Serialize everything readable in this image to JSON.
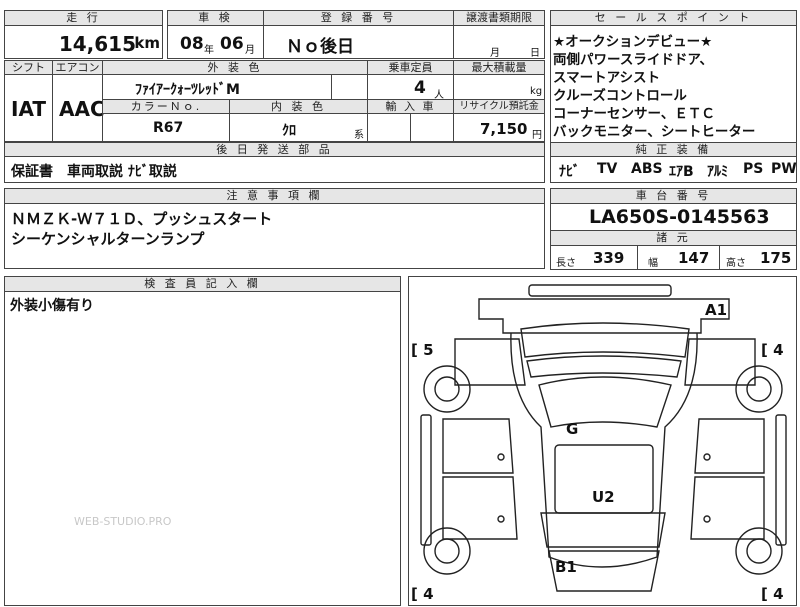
{
  "top": {
    "mileage_label": "走 行",
    "mileage_value": "14,615",
    "mileage_unit": "km",
    "inspection_label": "車 検",
    "inspection_year": "08",
    "inspection_year_unit": "年",
    "inspection_month": "06",
    "inspection_month_unit": "月",
    "registration_label": "登 録 番 号",
    "registration_value": "Ｎｏ後日",
    "transfer_label": "譲渡書類期限",
    "transfer_month_unit": "月",
    "transfer_day_unit": "日"
  },
  "row2": {
    "shift_label": "シフト",
    "ac_label": "エアコン",
    "exterior_label": "外 装 色",
    "capacity_label": "乗車定員",
    "max_load_label": "最大積載量",
    "shift_value": "IAT",
    "ac_value": "AAC",
    "exterior_value": "ﾌｧｲｱｰｸｫｰﾂﾚｯﾄﾞM",
    "capacity_value": "4",
    "capacity_unit": "人",
    "max_load_unit": "kg",
    "color_no_label": "カラーＮｏ.",
    "interior_label": "内 装 色",
    "import_label": "輸 入 車",
    "recycle_label": "リサイクル預託金",
    "color_no_value": "R67",
    "interior_value": "ｸﾛ",
    "interior_suffix": "系",
    "recycle_value": "7,150",
    "recycle_unit": "円"
  },
  "later_parts": {
    "label": "後 日 発 送 部 品",
    "value": "保証書　車両取説 ﾅﾋﾞ取説"
  },
  "caution": {
    "label": "注 意 事 項 欄",
    "line1": "ＮＭＺＫ-Ｗ７１Ｄ、プッシュスタート",
    "line2": "シーケンシャルターンランプ"
  },
  "inspector": {
    "label": "検 査 員 記 入 欄",
    "value": "外装小傷有り"
  },
  "sales_points": {
    "label": "セ ー ル ス ポ イ ン ト",
    "lines": [
      "★オークションデビュー★",
      "両側パワースライドドア、",
      "スマートアシスト",
      "クルーズコントロール",
      "コーナーセンサー、ＥＴＣ",
      "バックモニター、シートヒーター"
    ]
  },
  "equipment": {
    "label": "純 正 装 備",
    "items": [
      "ﾅﾋﾞ",
      "TV",
      "ABS",
      "ｴｱB",
      "ｱﾙﾐ",
      "PS",
      "PW"
    ]
  },
  "chassis": {
    "label": "車 台 番 号",
    "value": "LA650S-0145563"
  },
  "specs": {
    "label": "諸 元",
    "length_label": "長さ",
    "length_value": "339",
    "width_label": "幅",
    "width_value": "147",
    "height_label": "高さ",
    "height_value": "175"
  },
  "diagram": {
    "marks": {
      "a1": "A1",
      "g": "G",
      "u2": "U2",
      "b1": "B1",
      "left_top": "[ 5",
      "right_top": "[ 4",
      "left_bottom": "[ 4",
      "right_bottom": "[ 4"
    }
  },
  "watermark": "WEB-STUDIO.PRO"
}
